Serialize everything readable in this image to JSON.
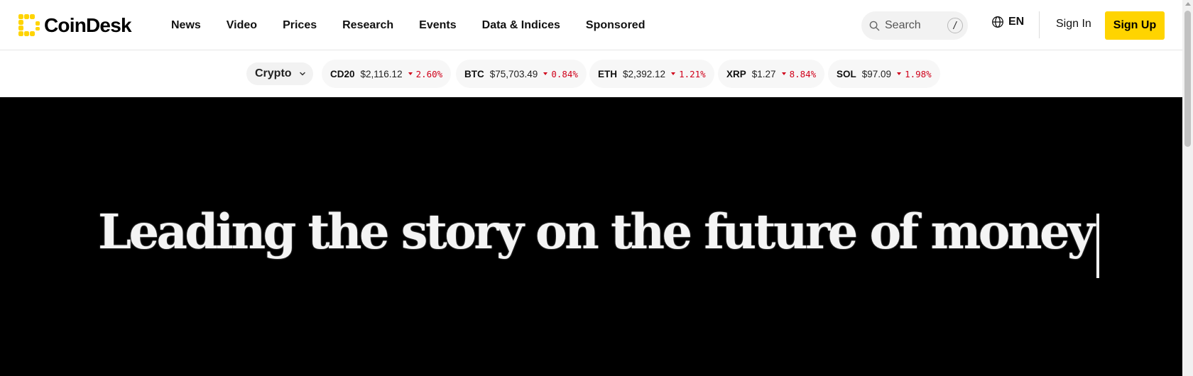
{
  "brand": {
    "name": "CoinDesk",
    "accent": "#ffd400"
  },
  "nav": {
    "items": [
      "News",
      "Video",
      "Prices",
      "Research",
      "Events",
      "Data & Indices",
      "Sponsored"
    ]
  },
  "search": {
    "placeholder": "Search",
    "shortcut": "/"
  },
  "lang": {
    "label": "EN"
  },
  "auth": {
    "sign_in": "Sign In",
    "sign_up": "Sign Up"
  },
  "ticker": {
    "selector": "Crypto",
    "items": [
      {
        "symbol": "CD20",
        "price": "$2,116.12",
        "change": "2.60%",
        "direction": "down"
      },
      {
        "symbol": "BTC",
        "price": "$75,703.49",
        "change": "0.84%",
        "direction": "down"
      },
      {
        "symbol": "ETH",
        "price": "$2,392.12",
        "change": "1.21%",
        "direction": "down"
      },
      {
        "symbol": "XRP",
        "price": "$1.27",
        "change": "8.84%",
        "direction": "down"
      },
      {
        "symbol": "SOL",
        "price": "$97.09",
        "change": "1.98%",
        "direction": "down"
      }
    ],
    "down_color": "#d0021b"
  },
  "hero": {
    "headline": "Leading the story on the future of money"
  }
}
